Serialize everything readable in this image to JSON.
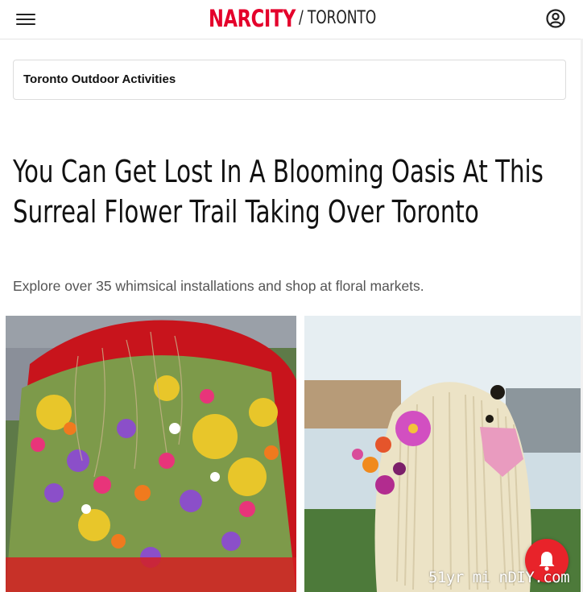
{
  "header": {
    "logo_text": "NARCITY",
    "section_label": "/ TORONTO",
    "logo_color": "#e4002b",
    "menu_icon": "hamburger-menu-icon",
    "account_icon": "user-account-icon"
  },
  "breadcrumb": {
    "label": "Toronto Outdoor Activities"
  },
  "article": {
    "title": "You Can Get Lost In A Blooming Oasis At This Surreal Flower Trail Taking Over Toronto",
    "subtitle": "Explore over 35 whimsical installations and shop at floral markets."
  },
  "images": [
    {
      "name": "flower-car-installation-photo"
    },
    {
      "name": "flower-sheepdog-sculpture-photo"
    }
  ],
  "notification": {
    "icon": "bell-icon",
    "color": "#e8232a"
  },
  "watermark": {
    "text": "51yr mi nDIY.com"
  }
}
